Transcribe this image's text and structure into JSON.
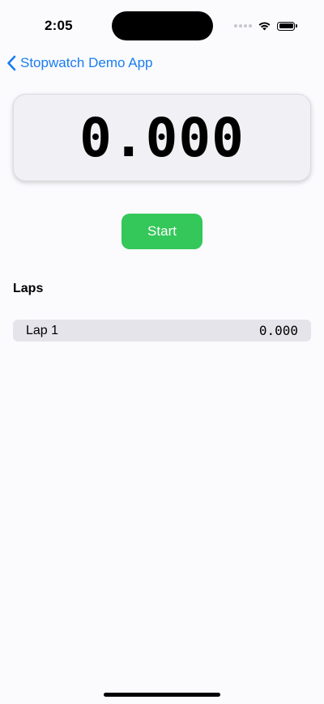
{
  "status_bar": {
    "time": "2:05",
    "wifi_icon": "wifi-icon",
    "battery_icon": "battery-icon"
  },
  "nav": {
    "back_label": "Stopwatch Demo App",
    "back_icon": "chevron-left-icon",
    "accent_color": "#1a7cf0"
  },
  "timer": {
    "display": "0.000"
  },
  "controls": {
    "start_label": "Start",
    "start_color": "#34c759"
  },
  "laps": {
    "heading": "Laps",
    "items": [
      {
        "label": "Lap 1",
        "time": "0.000"
      }
    ]
  }
}
